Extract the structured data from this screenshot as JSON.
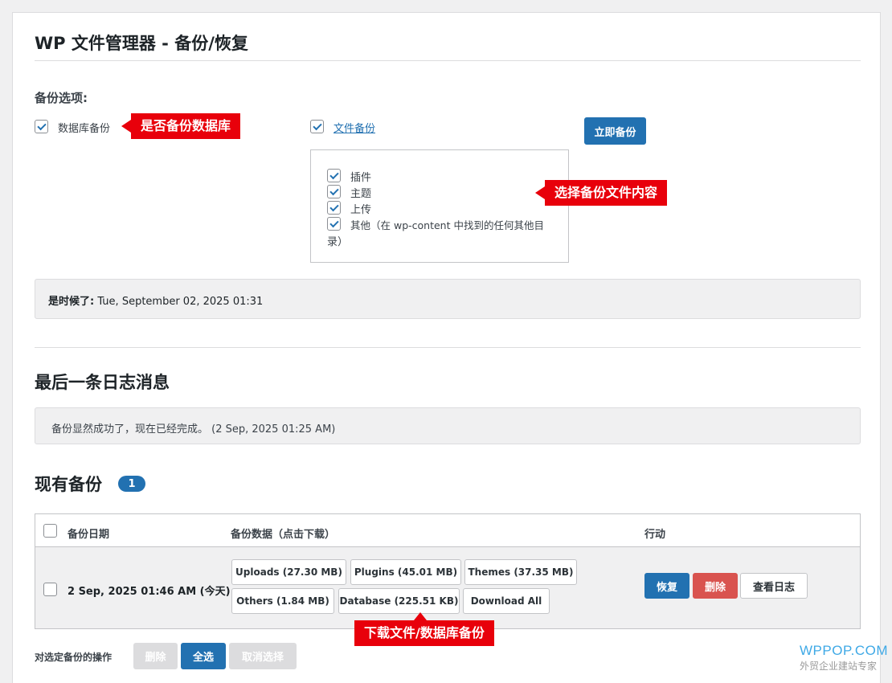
{
  "page": {
    "title": "WP 文件管理器 - 备份/恢复"
  },
  "backup_options": {
    "heading": "备份选项:",
    "database_label": "数据库备份",
    "database_callout": "是否备份数据库",
    "files_label": "文件备份",
    "backup_now_button": "立即备份",
    "file_items": [
      "插件",
      "主题",
      "上传",
      "其他（在 wp-content 中找到的任何其他目",
      "录）"
    ],
    "files_callout": "选择备份文件内容"
  },
  "schedule": {
    "label": "是时候了:",
    "value": "Tue, September 02, 2025 01:31"
  },
  "last_log": {
    "heading": "最后一条日志消息",
    "message": "备份显然成功了，现在已经完成。 (2 Sep, 2025 01:25 AM)"
  },
  "existing": {
    "heading": "现有备份",
    "count": "1",
    "columns": {
      "date": "备份日期",
      "data": "备份数据（点击下载）",
      "actions": "行动"
    },
    "rows": [
      {
        "date": "2 Sep, 2025 01:46 AM (今天)",
        "downloads": [
          "Uploads (27.30 MB)",
          "Plugins (45.01 MB)",
          "Themes (37.35 MB)",
          "Others (1.84 MB)",
          "Database (225.51 KB)",
          "Download All"
        ],
        "restore": "恢复",
        "delete": "删除",
        "view_log": "查看日志"
      }
    ],
    "download_callout": "下载文件/数据库备份"
  },
  "bulk": {
    "label": "对选定备份的操作",
    "delete": "删除",
    "select_all": "全选",
    "deselect": "取消选择"
  },
  "watermark": {
    "title": "WPPOP.COM",
    "subtitle": "外贸企业建站专家"
  },
  "colors": {
    "primary": "#2271b1",
    "danger": "#d9534f",
    "callout": "#e8000b"
  }
}
